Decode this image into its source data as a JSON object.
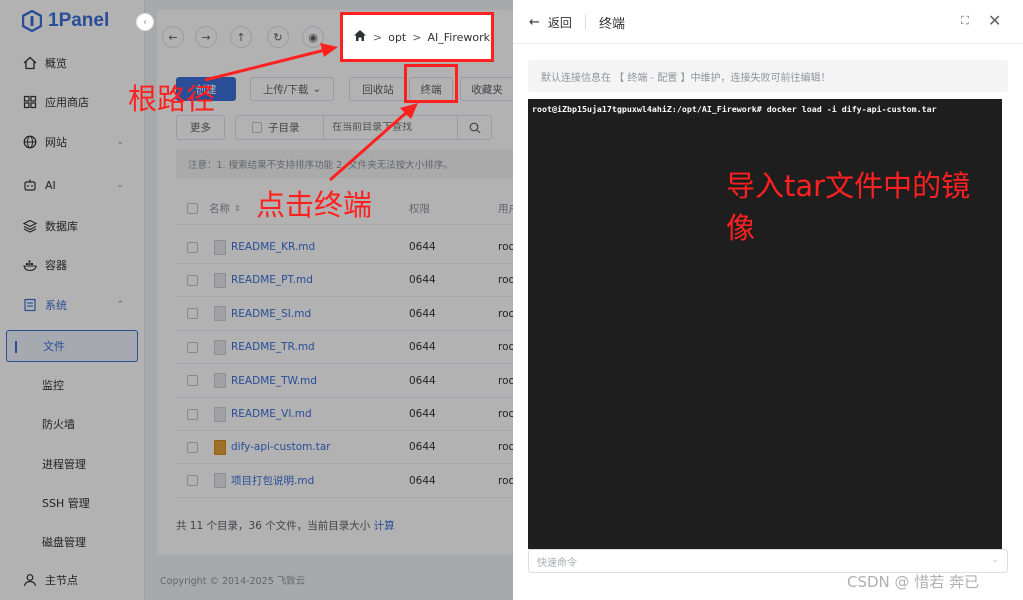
{
  "app": {
    "logo_text": "1Panel",
    "collapse_glyph": "‹"
  },
  "sidebar": {
    "items": [
      {
        "label": "概览",
        "icon": "home-icon"
      },
      {
        "label": "应用商店",
        "icon": "grid-icon"
      },
      {
        "label": "网站",
        "icon": "globe-icon"
      },
      {
        "label": "AI",
        "icon": "robot-icon"
      },
      {
        "label": "数据库",
        "icon": "layers-icon"
      },
      {
        "label": "容器",
        "icon": "whale-icon"
      },
      {
        "label": "系统",
        "icon": "system-icon"
      }
    ],
    "sub_items": [
      "文件",
      "监控",
      "防火墙",
      "进程管理",
      "SSH 管理",
      "磁盘管理"
    ],
    "footer": "主节点",
    "chev_down": "⌄",
    "chev_up": "⌃"
  },
  "toolbar": {
    "nav_glyphs": [
      "←",
      "→",
      "↑",
      "↻",
      "◉"
    ],
    "breadcrumb": [
      "opt",
      "AI_Firework"
    ],
    "breadcrumb_sep": ">",
    "create_label": "创建",
    "upload_label": "上传/下载",
    "recycle_label": "回收站",
    "terminal_label": "终端",
    "favorites_label": "收藏夹",
    "more_label": "更多"
  },
  "search": {
    "subdir_label": "子目录",
    "placeholder": "在当前目录下查找"
  },
  "notice": "注意：1. 搜索结果不支持排序功能 2. 文件夹无法按大小排序。",
  "table": {
    "columns": [
      "名称",
      "权限",
      "用户"
    ],
    "rows": [
      {
        "name": "README_KR.md",
        "perm": "0644",
        "user": "root",
        "type": "file"
      },
      {
        "name": "README_PT.md",
        "perm": "0644",
        "user": "root",
        "type": "file"
      },
      {
        "name": "README_SI.md",
        "perm": "0644",
        "user": "root",
        "type": "file"
      },
      {
        "name": "README_TR.md",
        "perm": "0644",
        "user": "root",
        "type": "file"
      },
      {
        "name": "README_TW.md",
        "perm": "0644",
        "user": "root",
        "type": "file"
      },
      {
        "name": "README_VI.md",
        "perm": "0644",
        "user": "root",
        "type": "file"
      },
      {
        "name": "dify-api-custom.tar",
        "perm": "0644",
        "user": "root",
        "type": "tar"
      },
      {
        "name": "项目打包说明.md",
        "perm": "0644",
        "user": "root",
        "type": "file"
      }
    ]
  },
  "summary": {
    "text": "共 11 个目录，36 个文件，当前目录大小 ",
    "link": "计算"
  },
  "copyright": "Copyright © 2014-2025 飞致云",
  "drawer": {
    "back_label": "返回",
    "title": "终端",
    "fullscreen_glyph": "⛶",
    "close_glyph": "✕",
    "info": "默认连接信息在 【 终端 - 配置 】中维护，连接失败可前往编辑！",
    "terminal_line": "root@iZbp15uja17tgpuxwl4ahiZ:/opt/AI_Firework# docker load -i dify-api-custom.tar",
    "quick_placeholder": "快速命令"
  },
  "annotations": {
    "root_path": "根路径",
    "click_terminal": "点击终端",
    "import_line1": "导入tar文件中的镜",
    "import_line2": "像",
    "color": "#ff2020"
  },
  "watermark": "CSDN @ 惜若 奔已"
}
